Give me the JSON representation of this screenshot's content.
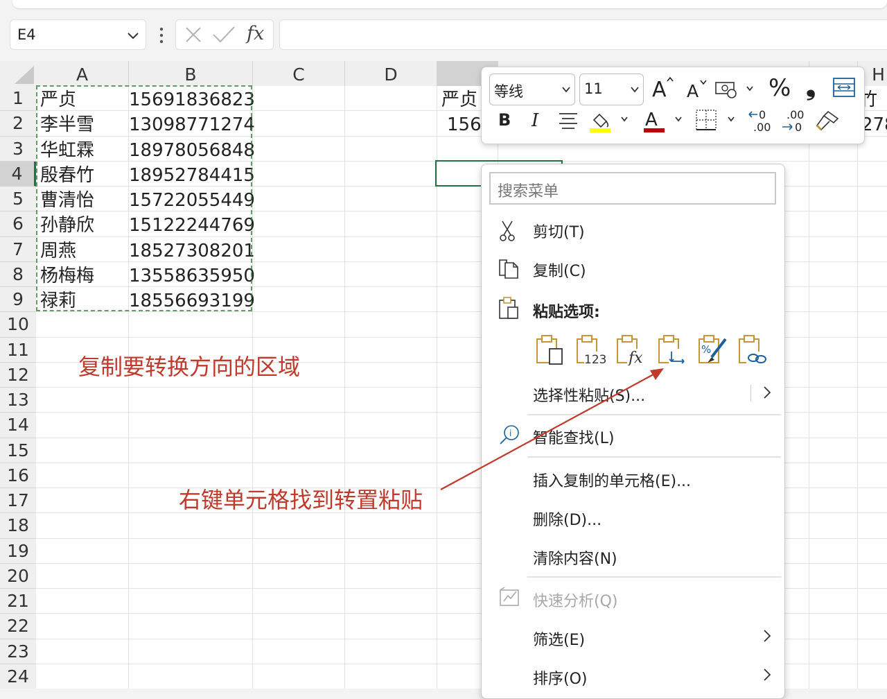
{
  "formula_bar": {
    "name_box": "E4",
    "cancel_icon": "cancel-icon",
    "enter_icon": "check-icon",
    "fx_label": "fx",
    "formula_value": ""
  },
  "columns": [
    "A",
    "B",
    "C",
    "D",
    "",
    "",
    "",
    "H"
  ],
  "rows": [
    "1",
    "2",
    "3",
    "4",
    "5",
    "6",
    "7",
    "8",
    "9",
    "10",
    "11",
    "12",
    "13",
    "14",
    "15",
    "16",
    "17",
    "18",
    "19",
    "20",
    "21",
    "22",
    "23",
    "24"
  ],
  "selected_row": "4",
  "data": [
    {
      "name": "严贞",
      "phone": "15691836823"
    },
    {
      "name": "李半雪",
      "phone": "13098771274"
    },
    {
      "name": "华虹霖",
      "phone": "18978056848"
    },
    {
      "name": "殷春竹",
      "phone": "18952784415"
    },
    {
      "name": "曹清怡",
      "phone": "15722055449"
    },
    {
      "name": "孙静欣",
      "phone": "15122244769"
    },
    {
      "name": "周燕",
      "phone": "18527308201"
    },
    {
      "name": "杨梅梅",
      "phone": "13558635950"
    },
    {
      "name": "禄莉",
      "phone": "18556693199"
    }
  ],
  "partial_cells": {
    "e1": "严贞",
    "e2": "1569",
    "g1": "竹",
    "g2": "278"
  },
  "annotations": {
    "copy_note": "复制要转换方向的区域",
    "rightclick_note": "右键单元格找到转置粘贴",
    "color": "#c0392b"
  },
  "mini_toolbar": {
    "font_name": "等线",
    "font_size": "11",
    "bold": "B",
    "italic": "I",
    "font_color_label": "A",
    "fill_color": "#ffff00",
    "font_color": "#c00000",
    "percent": "%",
    "comma": "❟",
    "inc_decimal": "←0 .00",
    "dec_decimal": ".00 →0"
  },
  "context_menu": {
    "search_placeholder": "搜索菜单",
    "cut": "剪切(T)",
    "copy": "复制(C)",
    "paste_options": "粘贴选项:",
    "paste_special": "选择性粘贴(S)...",
    "smart_lookup": "智能查找(L)",
    "insert_copied": "插入复制的单元格(E)...",
    "delete": "删除(D)...",
    "clear": "清除内容(N)",
    "quick_analysis": "快速分析(Q)",
    "filter": "筛选(E)",
    "sort": "排序(O)",
    "paste_buttons": [
      "paste-icon",
      "paste-values-123-icon",
      "paste-formulas-fx-icon",
      "paste-transpose-icon",
      "paste-formatting-icon",
      "paste-link-icon"
    ]
  },
  "colors": {
    "accent_green": "#217346",
    "selection_header": "#d2d2d2",
    "paste_icon": "#c69537"
  }
}
